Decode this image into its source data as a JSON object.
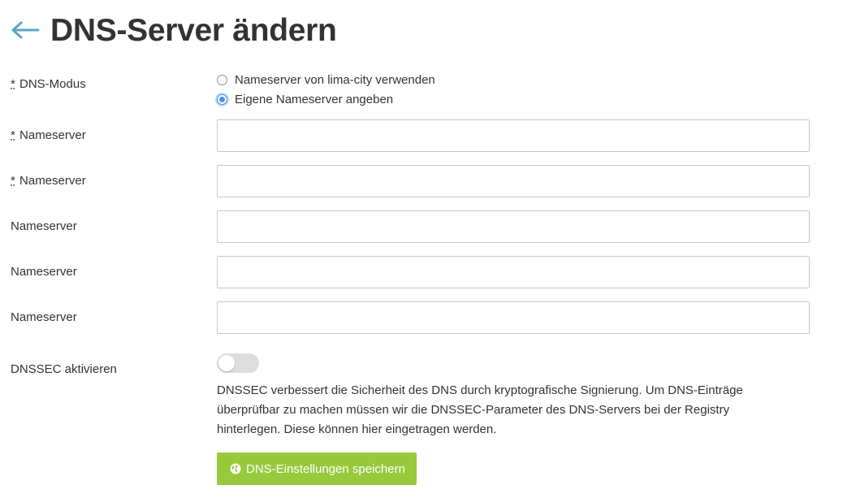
{
  "header": {
    "back_icon": "arrow-left-icon",
    "title": "DNS-Server ändern"
  },
  "colors": {
    "accent": "#5aa6c8",
    "button_green": "#97c93d",
    "radio_blue": "#4a90e2"
  },
  "form": {
    "required_marker": "*",
    "dns_mode": {
      "label": "DNS-Modus",
      "options": [
        {
          "label": "Nameserver von lima-city verwenden",
          "checked": false
        },
        {
          "label": "Eigene Nameserver angeben",
          "checked": true
        }
      ]
    },
    "nameservers": [
      {
        "label": "Nameserver",
        "required": true,
        "value": ""
      },
      {
        "label": "Nameserver",
        "required": true,
        "value": ""
      },
      {
        "label": "Nameserver",
        "required": false,
        "value": ""
      },
      {
        "label": "Nameserver",
        "required": false,
        "value": ""
      },
      {
        "label": "Nameserver",
        "required": false,
        "value": ""
      }
    ],
    "dnssec": {
      "label": "DNSSEC aktivieren",
      "enabled": false,
      "help": "DNSSEC verbessert die Sicherheit des DNS durch kryptografische Signierung. Um DNS-Einträge überprüfbar zu machen müssen wir die DNSSEC-Parameter des DNS-Servers bei der Registry hinterlegen. Diese können hier eingetragen werden."
    },
    "save_button": {
      "icon": "globe-icon",
      "label": "DNS-Einstellungen speichern"
    }
  }
}
